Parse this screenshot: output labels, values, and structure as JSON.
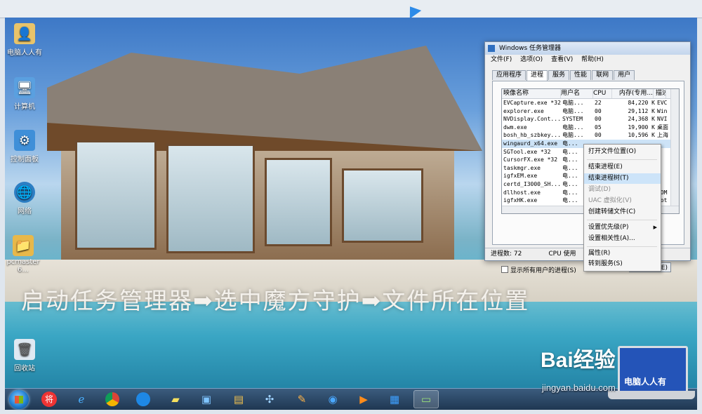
{
  "desktop": {
    "icons": [
      {
        "label": "电脑人人有",
        "icon": "user-folder-icon"
      },
      {
        "label": "计算机",
        "icon": "computer-icon"
      },
      {
        "label": "控制面板",
        "icon": "control-panel-icon"
      },
      {
        "label": "网络",
        "icon": "network-globe-icon"
      },
      {
        "label": "pcmaster 6...",
        "icon": "folder-icon"
      },
      {
        "label": "回收站",
        "icon": "recycle-bin-icon"
      }
    ],
    "caption": "启动任务管理器➡选中魔方守护➡文件所在位置"
  },
  "task_manager": {
    "title": "Windows 任务管理器",
    "menu": [
      "文件(F)",
      "选项(O)",
      "查看(V)",
      "帮助(H)"
    ],
    "tabs": [
      "应用程序",
      "进程",
      "服务",
      "性能",
      "联网",
      "用户"
    ],
    "active_tab": "进程",
    "columns": [
      "映像名称",
      "用户名",
      "CPU",
      "内存(专用...",
      "描述"
    ],
    "rows": [
      {
        "name": "EVCapture.exe *32",
        "user": "电脑...",
        "cpu": "22",
        "mem": "84,220 K",
        "desc": "EVC"
      },
      {
        "name": "explorer.exe",
        "user": "电脑...",
        "cpu": "00",
        "mem": "29,112 K",
        "desc": "Win"
      },
      {
        "name": "NVDisplay.Cont...",
        "user": "SYSTEM",
        "cpu": "00",
        "mem": "24,368 K",
        "desc": "NVI"
      },
      {
        "name": "dwm.exe",
        "user": "电脑...",
        "cpu": "05",
        "mem": "19,900 K",
        "desc": "桌面"
      },
      {
        "name": "bosh_hb_szbkey...",
        "user": "电脑...",
        "cpu": "00",
        "mem": "10,596 K",
        "desc": "上海"
      },
      {
        "name": "wingaurd_x64.exe",
        "user": "电...",
        "cpu": "",
        "mem": "",
        "desc": ""
      },
      {
        "name": "SGTool.exe *32",
        "user": "电...",
        "cpu": "",
        "mem": "",
        "desc": ""
      },
      {
        "name": "CursorFX.exe *32",
        "user": "电...",
        "cpu": "",
        "mem": "",
        "desc": ""
      },
      {
        "name": "taskmgr.exe",
        "user": "电...",
        "cpu": "",
        "mem": "",
        "desc": ""
      },
      {
        "name": "igfxEM.exe",
        "user": "电...",
        "cpu": "",
        "mem": "",
        "desc": ""
      },
      {
        "name": "certd_I3000_SH...",
        "user": "电...",
        "cpu": "",
        "mem": "",
        "desc": ""
      },
      {
        "name": "dllhost.exe",
        "user": "电...",
        "cpu": "",
        "mem": "",
        "desc": "COM"
      },
      {
        "name": "igfxHK.exe",
        "user": "电...",
        "cpu": "",
        "mem": "",
        "desc": "hot"
      },
      {
        "name": "",
        "user": "",
        "cpu": "",
        "mem": "",
        "desc": ""
      }
    ],
    "selected_row": "wingaurd_x64.exe",
    "show_all_users": "显示所有用户的进程(S)",
    "end_process": "结束进程(E)",
    "status_process_count": "进程数: 72",
    "status_cpu": "CPU 使用"
  },
  "context_menu": {
    "items": [
      "打开文件位置(O)",
      "结束进程(E)",
      "结束进程树(T)",
      "调试(D)",
      "UAC 虚拟化(V)",
      "创建转储文件(C)",
      "设置优先级(P)",
      "设置相关性(A)...",
      "属性(R)",
      "转到服务(S)"
    ],
    "highlighted": "结束进程树(T)"
  },
  "taskbar": {
    "buttons": [
      "start-orb",
      "jiang-app-icon",
      "internet-explorer-icon",
      "chrome-icon",
      "browser-app-icon",
      "sticky-notes-icon",
      "remote-desktop-icon",
      "file-manager-icon",
      "pinwheel-app-icon",
      "paint-icon",
      "media-player-icon",
      "video-player-icon",
      "tiles-app-icon",
      "task-manager-icon"
    ]
  },
  "watermark": {
    "brand": "Bai经验",
    "url": "jingyan.baidu.com",
    "laptop_text": "电脑人人有"
  },
  "colors": {
    "accent": "#2f6fc0",
    "selection": "#cde3f7",
    "menu_highlight": "#cde4f9"
  }
}
